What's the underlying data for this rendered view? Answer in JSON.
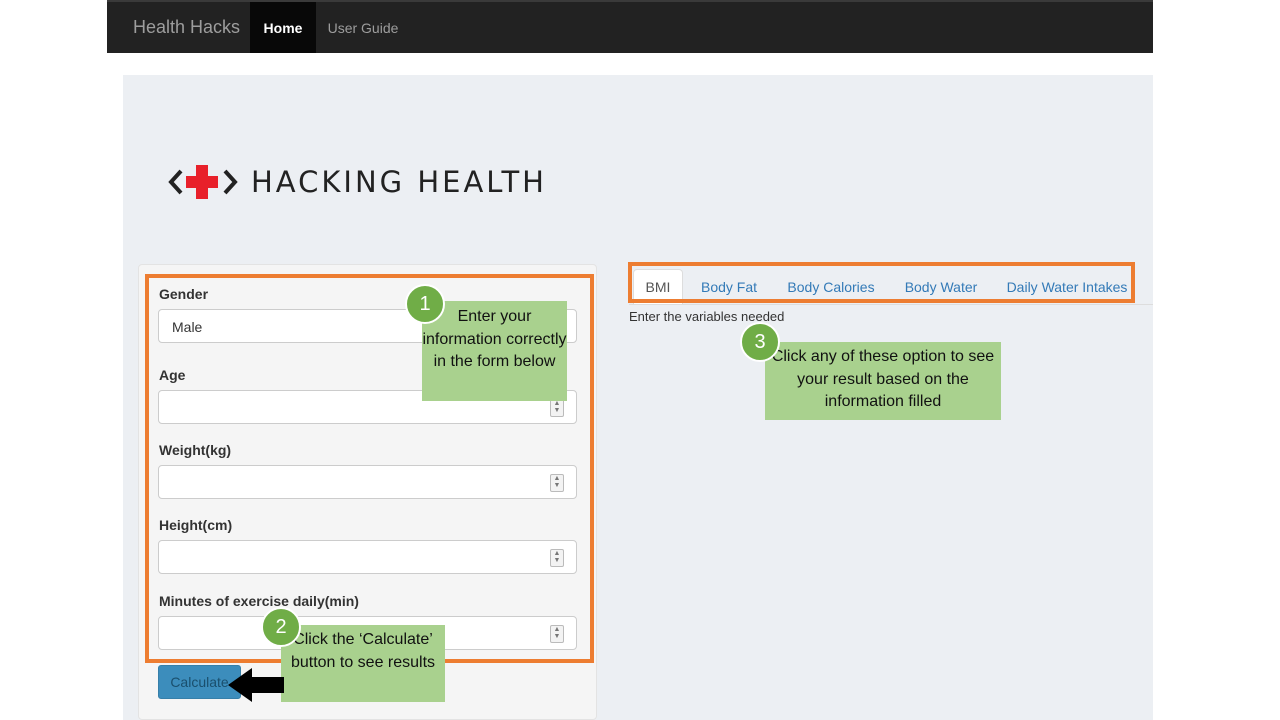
{
  "navbar": {
    "brand": "Health Hacks",
    "items": [
      {
        "label": "Home",
        "active": true
      },
      {
        "label": "User Guide",
        "active": false
      }
    ]
  },
  "logo": {
    "text": "HACKING HEALTH",
    "icon": "red-cross-logo-icon"
  },
  "form": {
    "gender_label": "Gender",
    "gender_value": "Male",
    "age_label": "Age",
    "weight_label": "Weight(kg)",
    "height_label": "Height(cm)",
    "exercise_label": "Minutes of exercise daily(min)",
    "calculate_label": "Calculate"
  },
  "tabs": [
    {
      "label": "BMI",
      "active": true
    },
    {
      "label": "Body Fat"
    },
    {
      "label": "Body Calories"
    },
    {
      "label": "Body Water"
    },
    {
      "label": "Daily Water Intakes"
    }
  ],
  "tab_content": "Enter the variables needed",
  "annotations": [
    {
      "number": "1",
      "text": "Enter your information correctly in the form below"
    },
    {
      "number": "2",
      "text": "Click the ‘Calculate’ button to see results"
    },
    {
      "number": "3",
      "text": "Click any of these option to see your result based on the information filled"
    }
  ],
  "colors": {
    "navbar": "#222222",
    "accent_orange": "#ed7d31",
    "note_green": "#a9d18e",
    "circle_green": "#70ad47",
    "button_blue": "#3c8dbc",
    "logo_red": "#e8202a"
  }
}
